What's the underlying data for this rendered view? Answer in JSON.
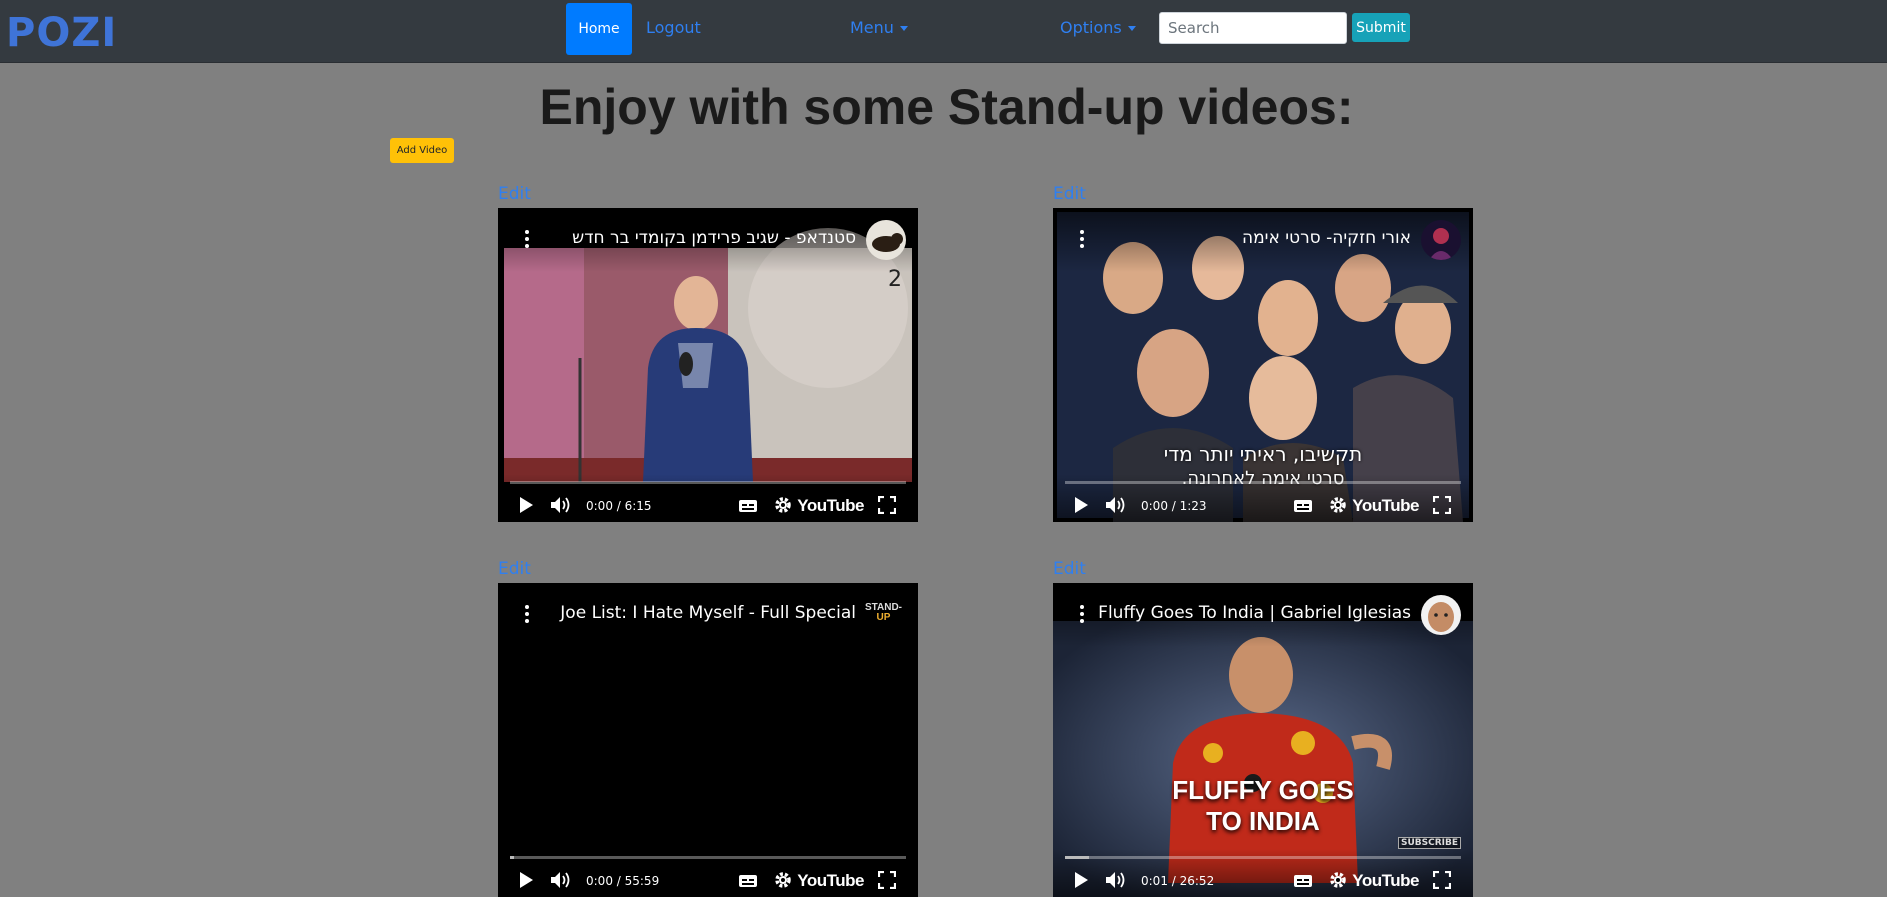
{
  "brand": "POZI",
  "nav": {
    "home": "Home",
    "logout": "Logout",
    "menu": "Menu",
    "options": "Options",
    "search_placeholder": "Search",
    "submit": "Submit"
  },
  "page": {
    "title": "Enjoy with some Stand-up videos:",
    "add_video": "Add Video"
  },
  "videos": [
    {
      "edit": "Edit",
      "title": "סטנדאפ - שגיב פרידמן בקומדי בר חדש",
      "time": "0:00 / 6:15",
      "progress": 0,
      "youtube": "YouTube"
    },
    {
      "edit": "Edit",
      "title": "אורי חזקיה- סרטי אימה",
      "time": "0:00 / 1:23",
      "progress": 0,
      "youtube": "YouTube",
      "caption_line1": "תקשיבו, ראיתי יותר מדי",
      "caption_line2": "סרטי אימה לאחרונה."
    },
    {
      "edit": "Edit",
      "title": "Joe List: I Hate Myself - Full Special",
      "time": "0:00 / 55:59",
      "progress": 0.01,
      "youtube": "YouTube",
      "channel_badge_line1": "STAND-",
      "channel_badge_line2": "UP"
    },
    {
      "edit": "Edit",
      "title": "Fluffy Goes To India | Gabriel Iglesias",
      "time": "0:01 / 26:52",
      "progress": 0.06,
      "youtube": "YouTube",
      "thumb_line1": "FLUFFY GOES",
      "thumb_line2": "TO INDIA",
      "subscribe": "SUBSCRIBE"
    }
  ],
  "colors": {
    "navbar": "#343a40",
    "page_bg": "#808080",
    "primary": "#007bff",
    "link": "#2f7ff0",
    "warning": "#ffc107",
    "info": "#17a2b8"
  }
}
